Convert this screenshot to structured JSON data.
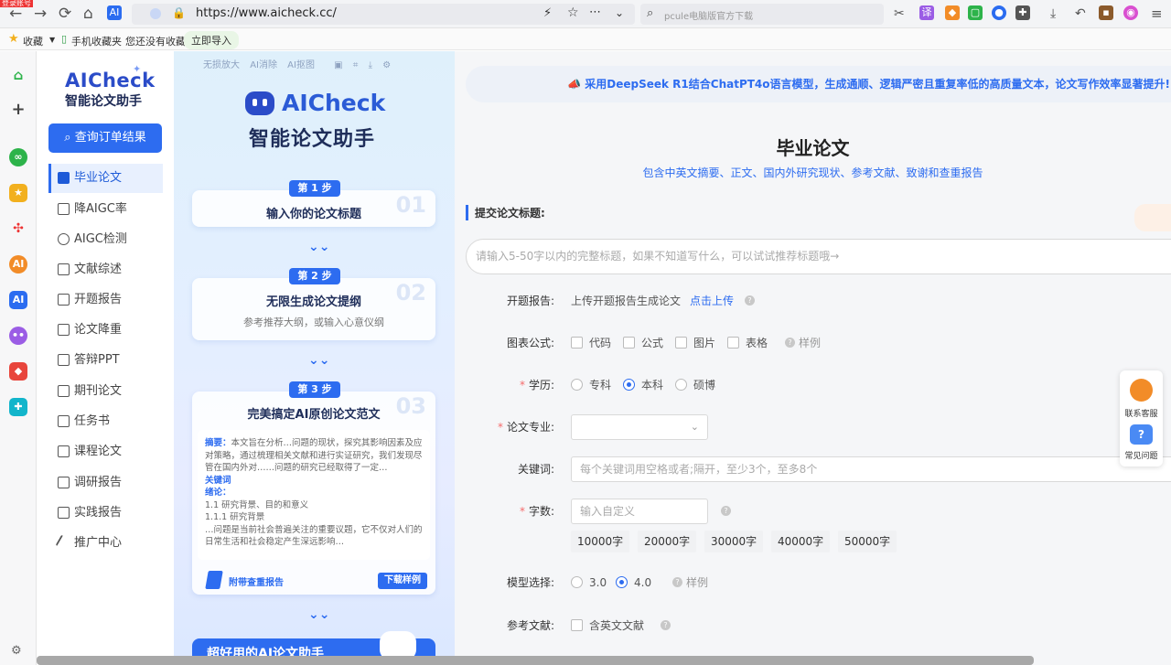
{
  "browser": {
    "red_tag": "登录账号",
    "url": "https://www.aicheck.cc/",
    "search_text": "pcule电脑版官方下载",
    "bookmarks": {
      "fav": "收藏",
      "mobile": "手机收藏夹",
      "empty": "您还没有收藏",
      "import": "立即导入"
    }
  },
  "sidebar": {
    "logo_title": "AICheck",
    "logo_subtitle": "智能论文助手",
    "query_button": "查询订单结果",
    "items": [
      {
        "label": "毕业论文",
        "active": true
      },
      {
        "label": "降AIGC率"
      },
      {
        "label": "AIGC检测"
      },
      {
        "label": "文献综述"
      },
      {
        "label": "开题报告"
      },
      {
        "label": "论文降重"
      },
      {
        "label": "答辩PPT"
      },
      {
        "label": "期刊论文"
      },
      {
        "label": "任务书"
      },
      {
        "label": "课程论文"
      },
      {
        "label": "调研报告"
      },
      {
        "label": "实践报告"
      },
      {
        "label": "推广中心"
      }
    ]
  },
  "promo": {
    "tools": [
      "无损放大",
      "AI消除",
      "AI抠图"
    ],
    "title": "AICheck",
    "subtitle": "智能论文助手",
    "steps": [
      {
        "badge": "第 1 步",
        "title": "输入你的论文标题",
        "num": "01"
      },
      {
        "badge": "第 2 步",
        "title": "无限生成论文提纲",
        "sub": "参考推荐大纲，或输入心意仪纲",
        "num": "02"
      },
      {
        "badge": "第 3 步",
        "title": "完美搞定AI原创论文范文",
        "num": "03"
      }
    ],
    "sample": {
      "abstract_label": "摘要：",
      "abstract_text": "本文旨在分析…问题的现状，探究其影响因素及应对策略，通过梳理相关文献和进行实证研究，我们发现尽管在国内外对……问题的研究已经取得了一定…",
      "keywords_label": "关键词",
      "intro_label": "绪论：",
      "line1": "1.1 研究背景、目的和意义",
      "line2": "1.1.1 研究背景",
      "line3": "…问题是当前社会普遍关注的重要议题，它不仅对人们的日常生活和社会稳定产生深远影响…"
    },
    "attach": "附带查重报告",
    "download": "下载样例",
    "bottom": "超好用的AI论文助手"
  },
  "main": {
    "banner": "采用DeepSeek R1结合ChatPT4o语言模型，生成通顺、逻辑严密且重复率低的高质量文本，论文写作效率显著提升!",
    "title": "毕业论文",
    "subtitle": "包含中英文摘要、正文、国内外研究现状、参考文献、致谢和查重报告",
    "title_label": "提交论文标题:",
    "title_placeholder": "请输入5-50字以内的完整标题，如果不知道写什么，可以试试推荐标题哦→",
    "proposal_label": "开题报告:",
    "proposal_text": "上传开题报告生成论文",
    "proposal_link": "点击上传",
    "chart_label": "图表公式:",
    "chart_opts": [
      "代码",
      "公式",
      "图片",
      "表格"
    ],
    "chart_sample": "样例",
    "degree_label": "学历:",
    "degree_opts": [
      "专科",
      "本科",
      "硕博"
    ],
    "major_label": "论文专业:",
    "keywords_label": "关键词:",
    "keywords_placeholder": "每个关键词用空格或者;隔开，至少3个，至多8个",
    "words_label": "字数:",
    "words_placeholder": "输入自定义",
    "word_opts": [
      "10000字",
      "20000字",
      "30000字",
      "40000字",
      "50000字"
    ],
    "model_label": "模型选择:",
    "model_opts": [
      "3.0",
      "4.0"
    ],
    "model_sample": "样例",
    "ref_label": "参考文献:",
    "ref_opt": "含英文文献"
  },
  "float": {
    "service": "联系客服",
    "faq": "常见问题"
  }
}
